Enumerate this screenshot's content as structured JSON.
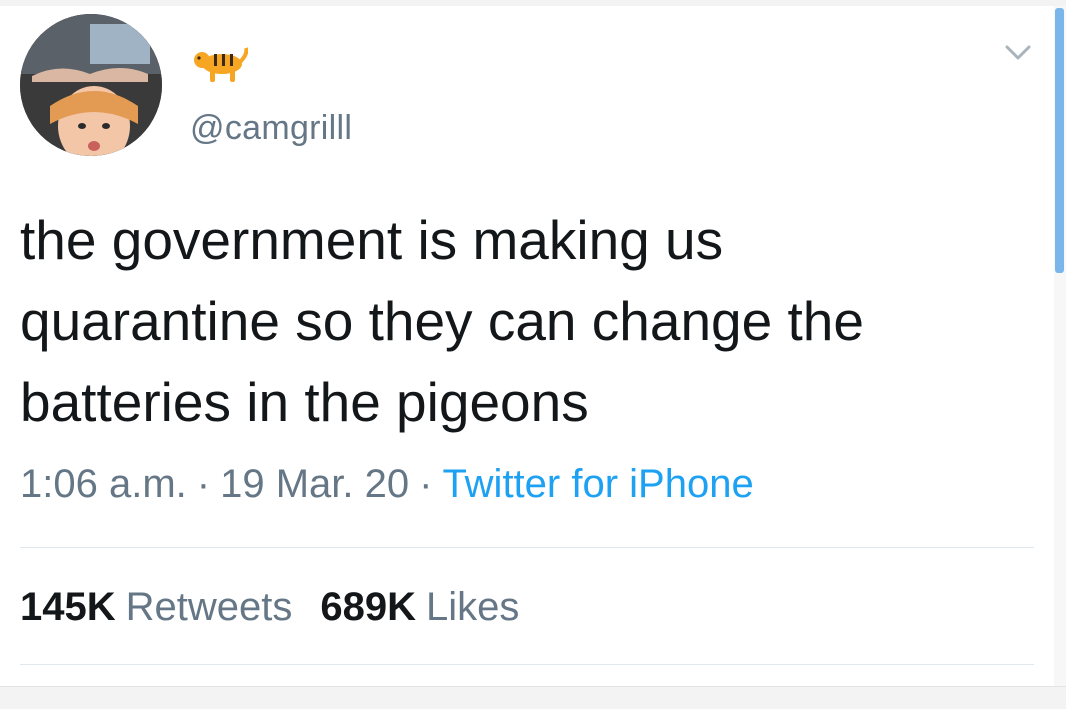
{
  "user": {
    "display_name_icon": "tiger-emoji",
    "handle": "@camgrilll",
    "avatar": "profile-photo"
  },
  "menu": {
    "icon": "chevron-down-icon"
  },
  "tweet": {
    "text": "the government is making us\nquarantine so they can change the\nbatteries in the pigeons"
  },
  "meta": {
    "time": "1:06 a.m.",
    "date": "19 Mar. 20",
    "separator": "·",
    "source": "Twitter for iPhone"
  },
  "stats": {
    "retweets_count": "145K",
    "retweets_label": "Retweets",
    "likes_count": "689K",
    "likes_label": "Likes"
  },
  "colors": {
    "text": "#14171a",
    "secondary": "#657786",
    "link": "#1da1f2",
    "divider": "#e1e8ed",
    "scroll": "#7bb6ea"
  }
}
